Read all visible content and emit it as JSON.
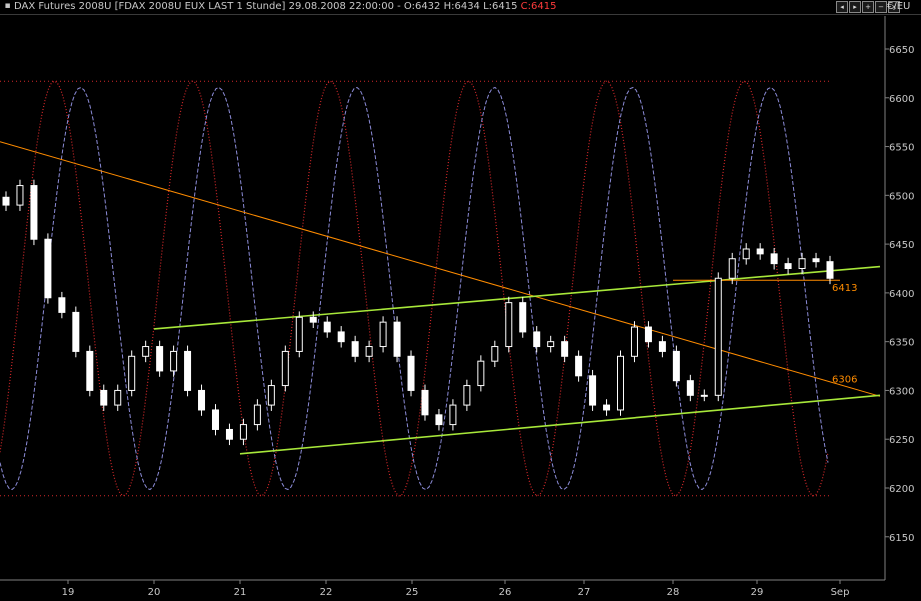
{
  "header": {
    "title_prefix": "DAX Futures 2008U [FDAX 2008U EUX LAST 1 Stunde] 29.08.2008 22:00:00 - O:6432 H:6434 L:6415 ",
    "close_value": "C:6415",
    "currency": "€/EU",
    "window_buttons": [
      "◂",
      "▸",
      "+",
      "−",
      "×"
    ]
  },
  "colors": {
    "background": "#000000",
    "axis_text": "#c8c8c8",
    "channel_line": "#a8e83a",
    "trend_line": "#ff8c00",
    "oscillator_fast": "#d4282a",
    "oscillator_slow": "#8c8cd8",
    "candles": "#ffffff",
    "last_price_tag": "#ffffff",
    "close_value": "#ff3b3b"
  },
  "chart_data": {
    "type": "candlestick",
    "title": "DAX Futures 2008U [FDAX 2008U EUX LAST 1 Stunde]",
    "ylim": [
      6100,
      6680
    ],
    "x_ticks": [
      "19",
      "20",
      "21",
      "22",
      "25",
      "26",
      "27",
      "28",
      "29",
      "Sep"
    ],
    "y_ticks": [
      6150,
      6200,
      6250,
      6300,
      6350,
      6400,
      6450,
      6500,
      6550,
      6600,
      6650
    ],
    "last_price": 6415,
    "close_path": [
      6490,
      6510,
      6455,
      6395,
      6380,
      6340,
      6300,
      6285,
      6300,
      6335,
      6345,
      6320,
      6340,
      6300,
      6280,
      6260,
      6250,
      6265,
      6285,
      6305,
      6340,
      6375,
      6370,
      6360,
      6350,
      6335,
      6345,
      6370,
      6335,
      6300,
      6275,
      6265,
      6285,
      6305,
      6330,
      6345,
      6390,
      6360,
      6345,
      6350,
      6335,
      6315,
      6285,
      6280,
      6335,
      6365,
      6350,
      6340,
      6310,
      6295,
      6295,
      6415,
      6435,
      6445,
      6440,
      6430,
      6425,
      6435,
      6432,
      6415
    ],
    "reference_lines": [
      {
        "value": 6617,
        "label": ""
      },
      {
        "value": 6192,
        "label": ""
      }
    ],
    "annotations": [
      {
        "label": "6413",
        "value": 6413
      },
      {
        "label": "6306",
        "value": 6306
      }
    ],
    "trendlines": [
      {
        "name": "",
        "color": "orange",
        "from": {
          "x": "start",
          "y": 6555
        },
        "to": {
          "x": "end",
          "y": 6294
        }
      },
      {
        "name": "",
        "color": "green",
        "from": {
          "x": "20",
          "y": 6363
        },
        "to": {
          "x": "end",
          "y": 6427
        }
      },
      {
        "name": "",
        "color": "green",
        "from": {
          "x": "21",
          "y": 6235
        },
        "to": {
          "x": "end",
          "y": 6295
        }
      },
      {
        "name": "",
        "color": "orange",
        "from": {
          "x": "28",
          "y": 6413
        },
        "to": {
          "x": "Sep",
          "y": 6413
        }
      }
    ],
    "series": [
      {
        "type": "oscillator",
        "style": "dotted",
        "color": "red"
      },
      {
        "type": "oscillator",
        "style": "dashed",
        "color": "blue"
      }
    ]
  }
}
